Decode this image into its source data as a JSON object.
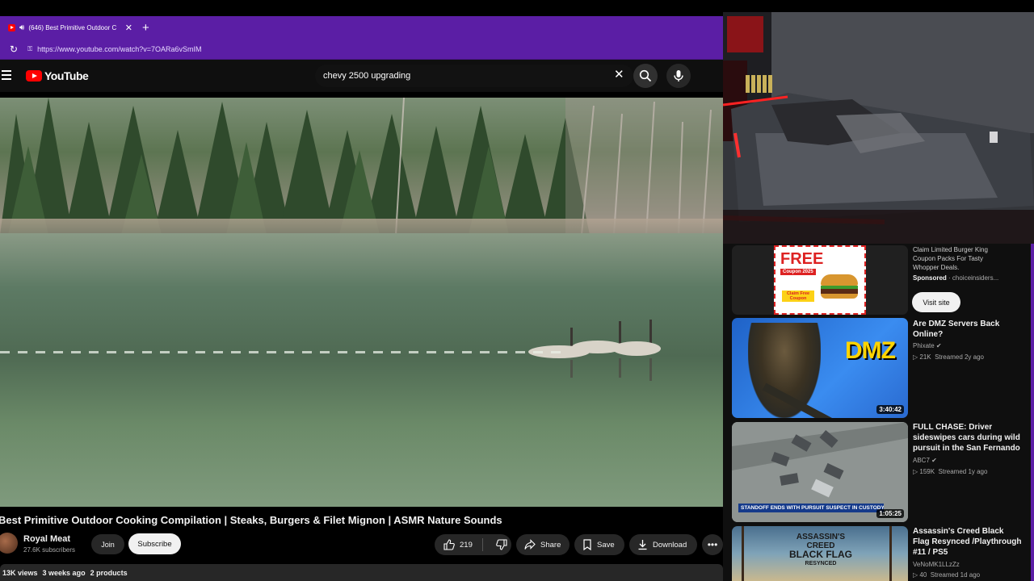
{
  "browser": {
    "tab_title": "(646) Best Primitive Outdoor C",
    "url": "https://www.youtube.com/watch?v=7OARa6vSmIM"
  },
  "youtube": {
    "logo_text": "YouTube",
    "search_query": "chevy 2500 upgrading"
  },
  "video": {
    "title": "Best Primitive Outdoor Cooking Compilation | Steaks, Burgers & Filet Mignon | ASMR Nature Sounds",
    "channel": "Royal Meat",
    "subscribers": "27.6K subscribers",
    "join_label": "Join",
    "subscribe_label": "Subscribe",
    "likes": "219",
    "share_label": "Share",
    "save_label": "Save",
    "download_label": "Download",
    "views": "13K views",
    "age": "3 weeks ago",
    "products": "2 products"
  },
  "ad": {
    "title_lines": [
      "Claim Limited Burger King",
      "Coupon Packs For Tasty",
      "Whopper Deals."
    ],
    "sponsored": "Sponsored",
    "advertiser": "choiceinsiders...",
    "cta": "Visit site",
    "thumb_free": "FREE",
    "thumb_coupon": "Coupon 2025",
    "thumb_claim": "Claim Free Coupon"
  },
  "recommendations": [
    {
      "title": "Are DMZ Servers Back Online?",
      "channel": "Phixate",
      "views": "21K",
      "age": "Streamed 2y ago",
      "duration": "3:40:42",
      "thumb_text": "DMZ"
    },
    {
      "title": "FULL CHASE: Driver sideswipes cars during wild pursuit in the San Fernando ...",
      "channel": "ABC7",
      "views": "159K",
      "age": "Streamed 1y ago",
      "duration": "1:05:25",
      "thumb_text": "STANDOFF ENDS WITH PURSUIT SUSPECT IN CUSTODY"
    },
    {
      "title": "Assassin's Creed Black Flag Resynced /Playthrough #11 / PS5",
      "channel": "VeNoMK1LLzZz",
      "views": "40",
      "age": "Streamed 1d ago",
      "duration": "",
      "thumb_text_1": "ASSASSIN'S",
      "thumb_text_2": "CREED",
      "thumb_text_3": "BLACK FLAG",
      "thumb_text_4": "RESYNCED"
    }
  ],
  "colors": {
    "browser_accent": "#5b1ea5",
    "yt_red": "#ff0000",
    "page_bg": "#0f0f0f"
  }
}
